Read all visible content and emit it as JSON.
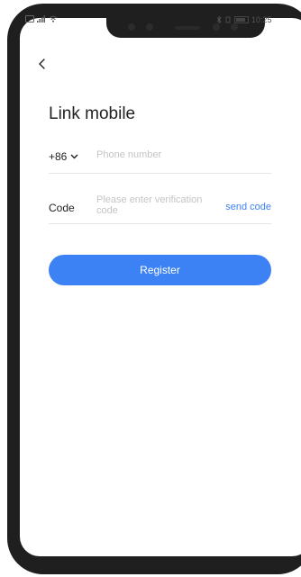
{
  "status": {
    "time": "10:25"
  },
  "page": {
    "title": "Link mobile"
  },
  "phone": {
    "country_code": "+86",
    "placeholder": "Phone number",
    "value": ""
  },
  "code": {
    "label": "Code",
    "placeholder": "Please enter verification code",
    "value": "",
    "send_label": "send code"
  },
  "register": {
    "label": "Register"
  },
  "colors": {
    "accent": "#3d82f5",
    "link": "#3b82f6",
    "frame": "#1f1f1f"
  },
  "icons": {
    "back": "chevron-left-icon",
    "dropdown": "chevron-down-icon"
  }
}
